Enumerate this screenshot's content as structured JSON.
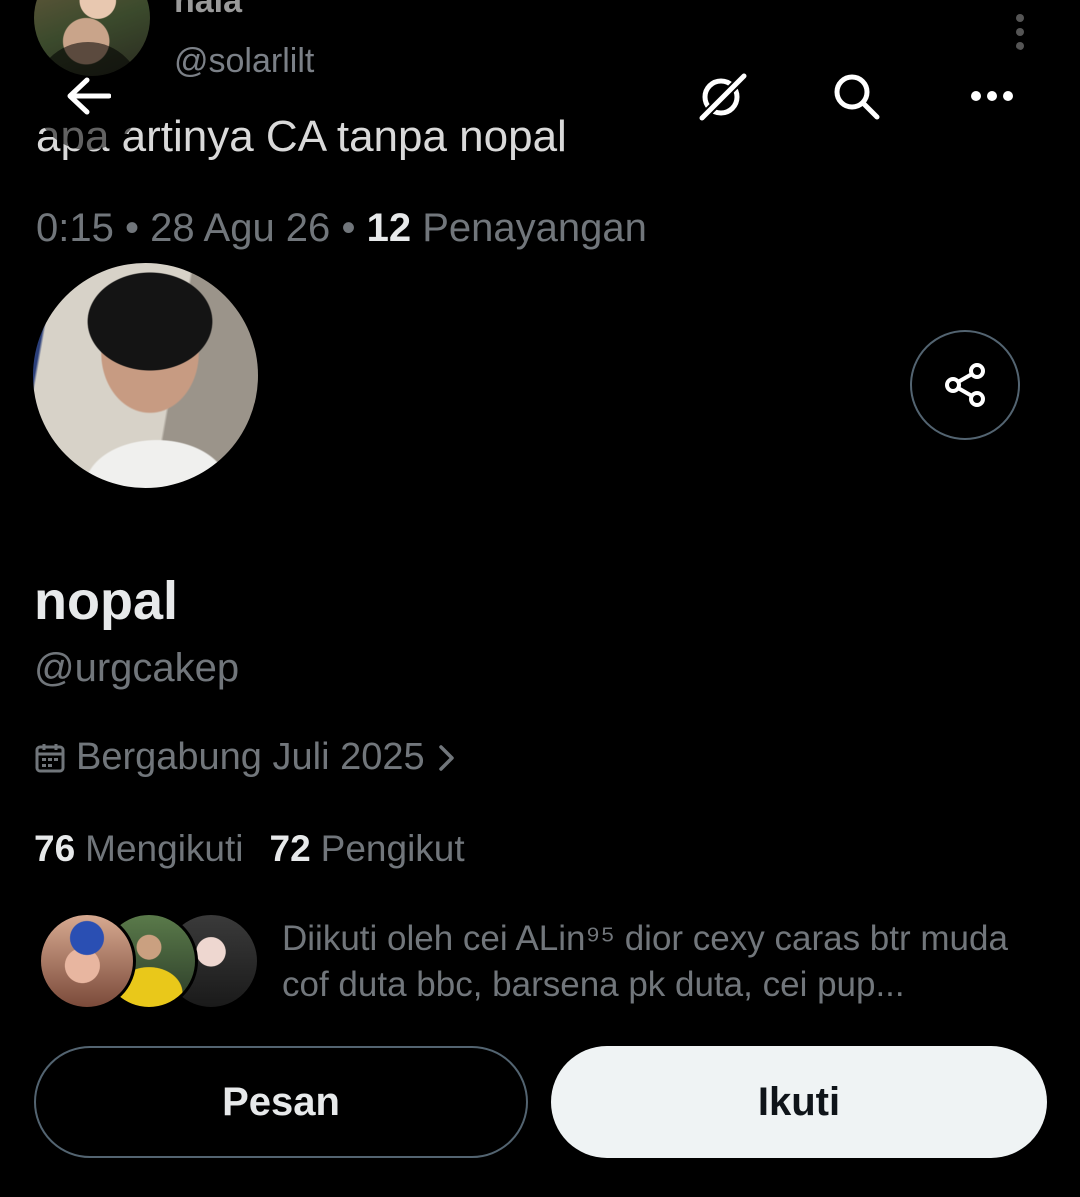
{
  "background_tweet": {
    "name": "nala",
    "handle": "@solarlilt",
    "text": "apa artinya CA tanpa nopal",
    "time": "0:15",
    "separator": "•",
    "date": "28 Agu 26",
    "views_count": "12",
    "views_label": "Penayangan"
  },
  "nav": {
    "back_icon": "arrow-left-icon",
    "grok_icon": "grok-icon",
    "search_icon": "search-icon",
    "more_icon": "more-horizontal-icon"
  },
  "profile": {
    "name": "nopal",
    "handle": "@urgcakep",
    "joined": "Bergabung Juli 2025",
    "following_count": "76",
    "following_label": "Mengikuti",
    "followers_count": "72",
    "followers_label": "Pengikut",
    "followed_by": "Diikuti oleh cei ALin⁹⁵ dior cexy caras btr muda cof duta bbc, barsena pk duta, cei pup..."
  },
  "actions": {
    "message_label": "Pesan",
    "follow_label": "Ikuti"
  }
}
